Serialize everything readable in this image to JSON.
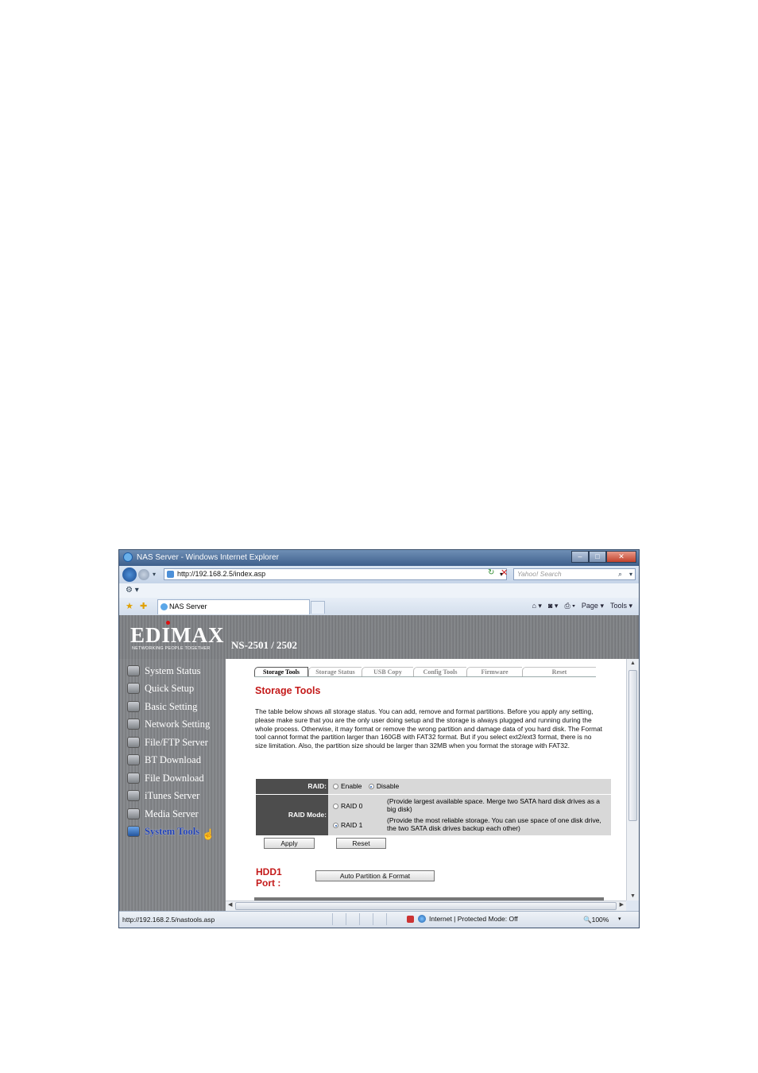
{
  "window": {
    "title": "NAS Server - Windows Internet Explorer",
    "controls": {
      "minimize": "–",
      "maximize": "□",
      "close": "✕"
    }
  },
  "address_bar": {
    "url": "http://192.168.2.5/index.asp"
  },
  "search": {
    "placeholder": "Yahoo! Search"
  },
  "tab": {
    "label": "NAS Server"
  },
  "commands": {
    "page": "Page ▾",
    "tools": "Tools ▾"
  },
  "header": {
    "brand": "EDIMAX",
    "tagline": "NETWORKING PEOPLE TOGETHER",
    "model": "NS-2501 / 2502"
  },
  "sidebar": {
    "items": [
      {
        "label": "System Status",
        "icon": "monitor-icon"
      },
      {
        "label": "Quick Setup",
        "icon": "lightning-icon"
      },
      {
        "label": "Basic Setting",
        "icon": "wrench-icon"
      },
      {
        "label": "Network Setting",
        "icon": "network-icon"
      },
      {
        "label": "File/FTP Server",
        "icon": "folder-icon"
      },
      {
        "label": "BT Download",
        "icon": "download-icon"
      },
      {
        "label": "File Download",
        "icon": "file-icon"
      },
      {
        "label": "iTunes Server",
        "icon": "music-icon"
      },
      {
        "label": "Media Server",
        "icon": "media-icon"
      },
      {
        "label": "System Tools",
        "icon": "tools-icon"
      }
    ],
    "active": "System Tools"
  },
  "subtabs": [
    "Storage Tools",
    "Storage Status",
    "USB Copy",
    "Config Tools",
    "Firmware",
    "Reset"
  ],
  "main": {
    "title": "Storage Tools",
    "description": "The table below shows all storage status. You can add, remove and format partitions. Before you apply any setting, please make sure that you are the only user doing setup and the storage is always plugged and running during the whole process. Otherwise, it may format or remove the wrong partition and damage data of you hard disk. The Format tool cannot format the partition larger than 160GB with FAT32 format. But if you select ext2/ext3 format, there is no size limitation. Also, the partition size should be larger than 32MB when you format the storage with FAT32.",
    "raid": {
      "label": "RAID:",
      "enable": "Enable",
      "disable": "Disable",
      "selected": "Disable"
    },
    "raid_mode": {
      "label": "RAID Mode:",
      "raid0": "RAID 0",
      "raid0_desc": "(Provide largest available space. Merge two SATA hard disk drives as a big disk)",
      "raid1": "RAID 1",
      "raid1_desc": "(Provide the most reliable storage. You can use space of one disk drive, the two SATA disk drives backup each other)",
      "selected": "RAID 1"
    },
    "apply_label": "Apply",
    "reset_label": "Reset",
    "hdd_title": "HDD1 Port :",
    "auto_partition_label": "Auto Partition & Format"
  },
  "status_bar": {
    "url": "http://192.168.2.5/nastools.asp",
    "zone": "Internet | Protected Mode: Off",
    "zoom": "100%"
  }
}
